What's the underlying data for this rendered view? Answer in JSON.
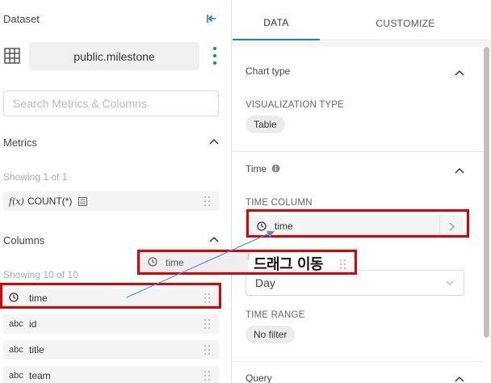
{
  "dataset": {
    "label": "Dataset",
    "name": "public.milestone"
  },
  "search": {
    "placeholder": "Search Metrics & Columns"
  },
  "metrics": {
    "title": "Metrics",
    "showing": "Showing 1 of 1",
    "items": [
      {
        "type": "f(x)",
        "name": "COUNT(*)"
      }
    ]
  },
  "columns": {
    "title": "Columns",
    "showing": "Showing 10 of 10",
    "items": [
      {
        "type": "clock-icon",
        "name": "time"
      },
      {
        "type": "abc",
        "name": "id"
      },
      {
        "type": "abc",
        "name": "title"
      },
      {
        "type": "abc",
        "name": "team"
      }
    ]
  },
  "tabs": [
    {
      "label": "DATA",
      "active": true
    },
    {
      "label": "CUSTOMIZE",
      "active": false
    }
  ],
  "chart_type": {
    "title": "Chart type",
    "viz_label": "VISUALIZATION TYPE",
    "viz_value": "Table"
  },
  "time": {
    "title": "Time",
    "column_label": "TIME COLUMN",
    "column_value": "time",
    "grain_label": "T",
    "grain_value": "Day",
    "range_label": "TIME RANGE",
    "range_value": "No filter"
  },
  "query": {
    "title": "Query"
  },
  "drag": {
    "ghost_label": "time",
    "annotation": "드래그 이동"
  },
  "colors": {
    "accent": "#1a85a0",
    "highlight": "#e00000",
    "arrow": "#4a90d9"
  }
}
